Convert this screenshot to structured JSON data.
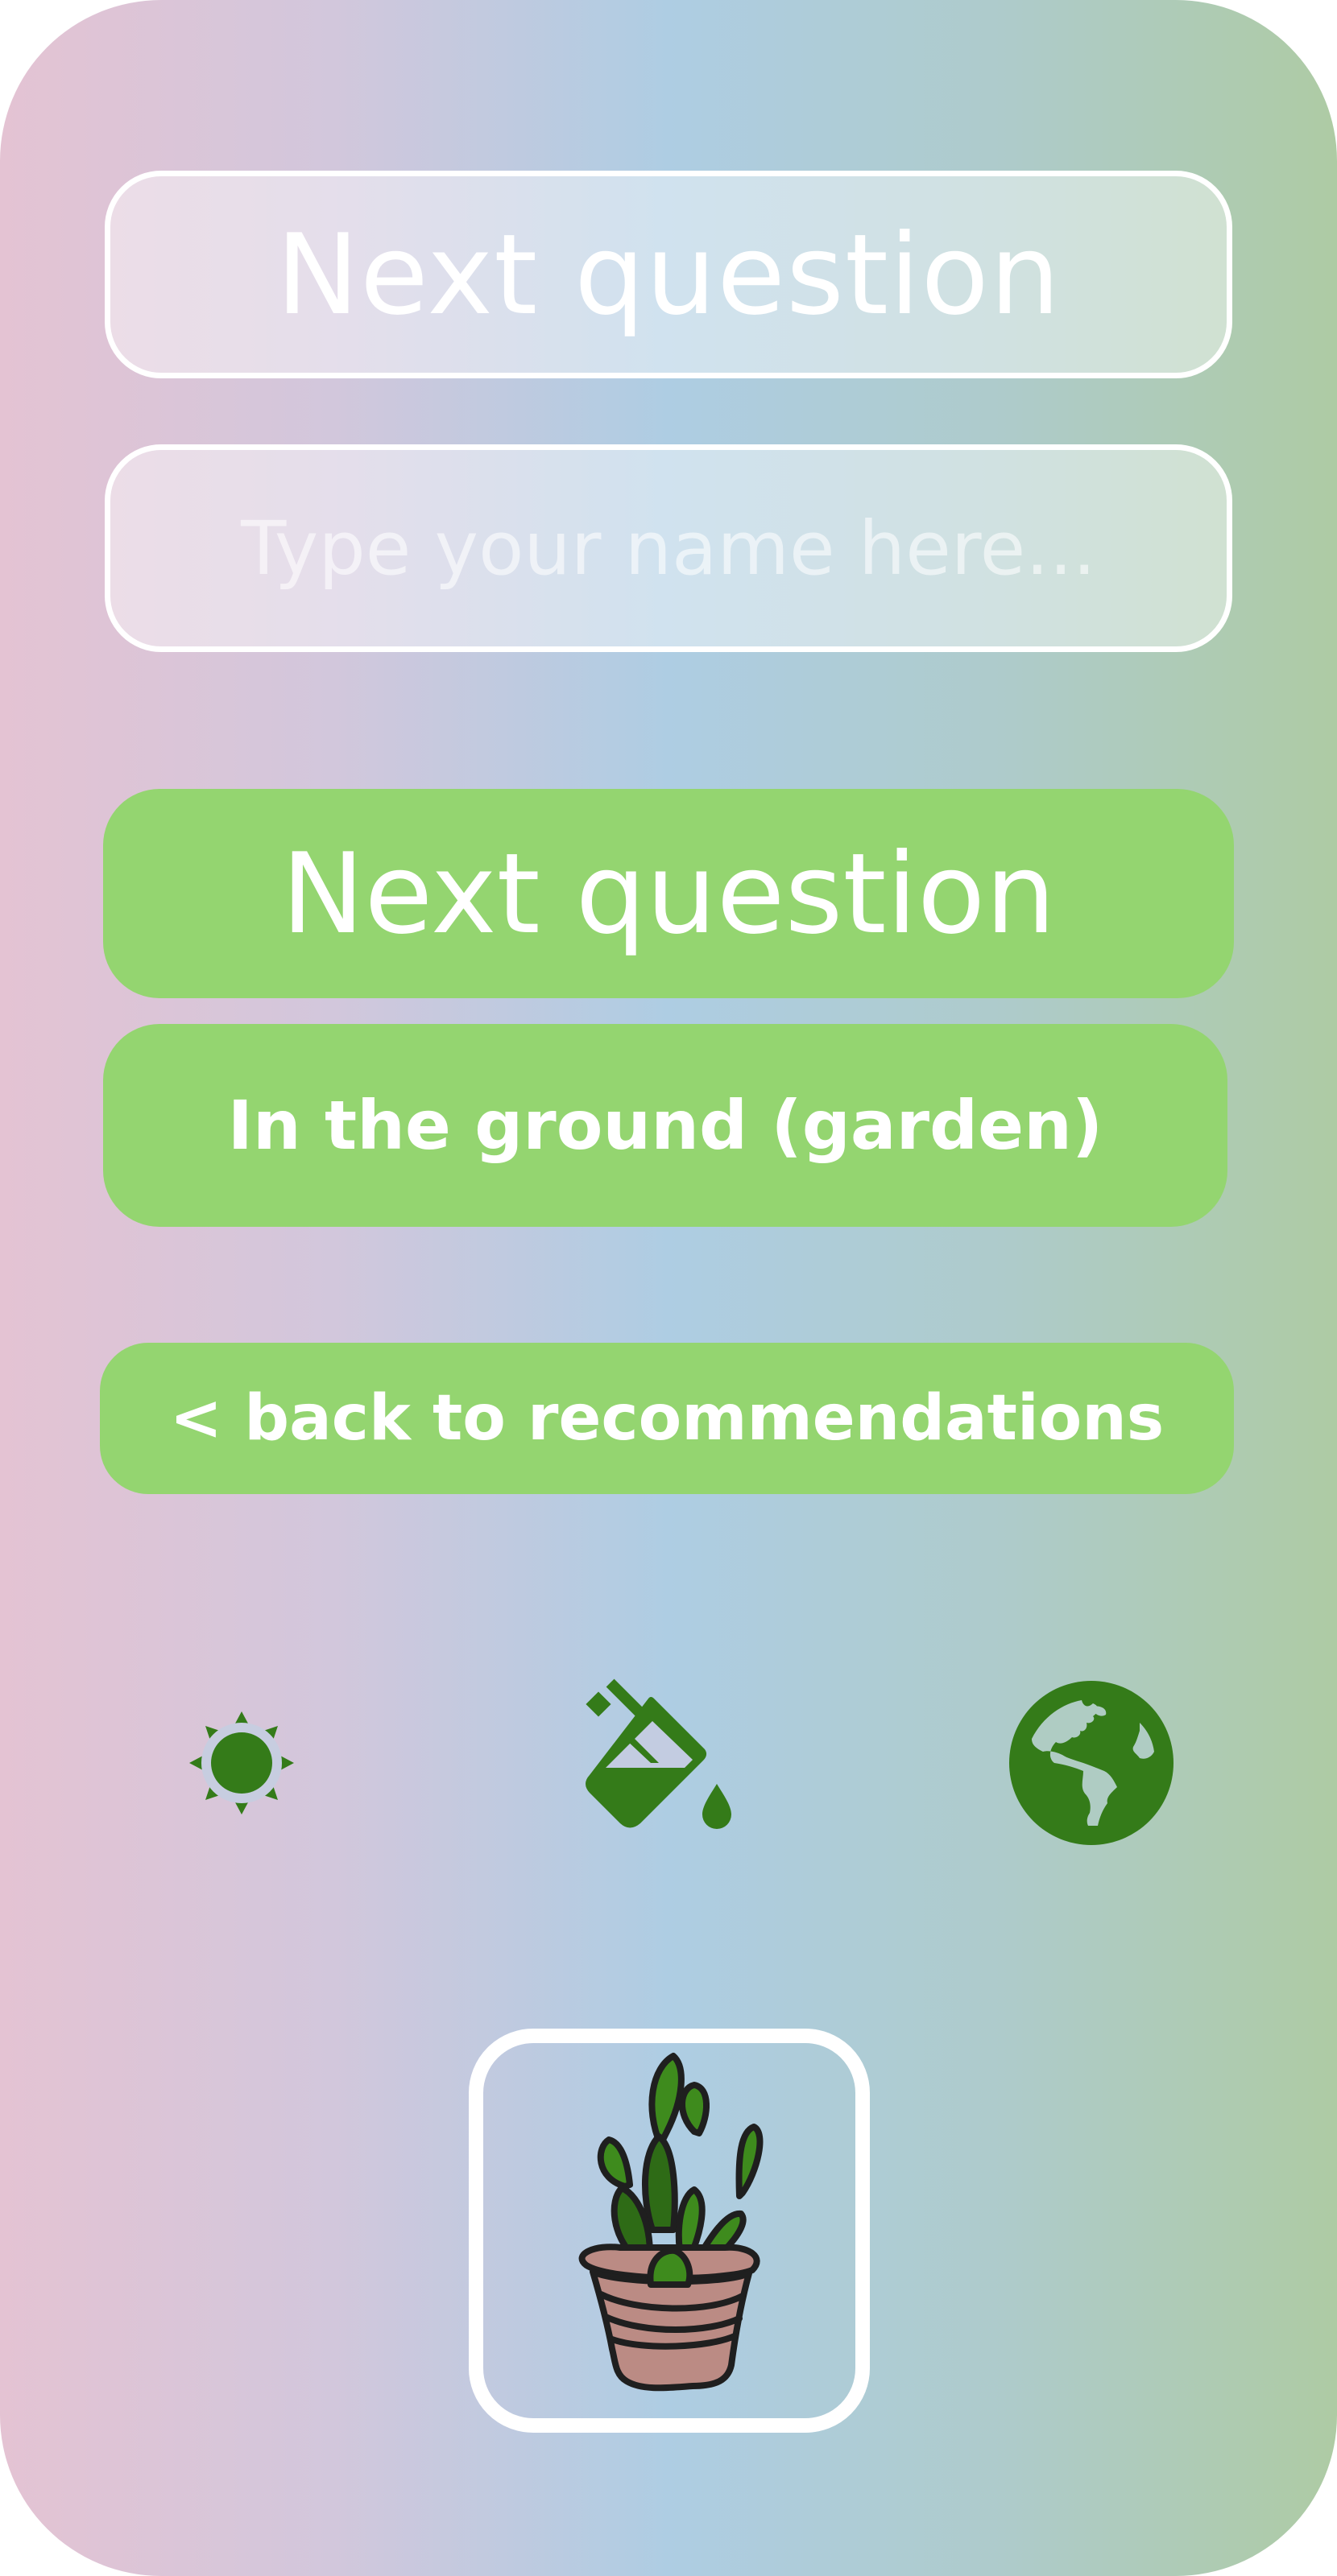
{
  "header": {
    "next_question_label": "Next question"
  },
  "name_field": {
    "placeholder": "Type your name here...",
    "value": ""
  },
  "buttons": {
    "next_question": "Next question",
    "answer_option": "In the ground (garden)",
    "back_link": "< back to recommendations"
  },
  "icons": {
    "sun": "sun-icon",
    "water": "watering-can-icon",
    "globe": "globe-icon",
    "plant": "potted-plant-icon"
  },
  "colors": {
    "accent_green": "#94d570",
    "icon_green": "#347b19",
    "pot_color": "#bb8b84"
  }
}
